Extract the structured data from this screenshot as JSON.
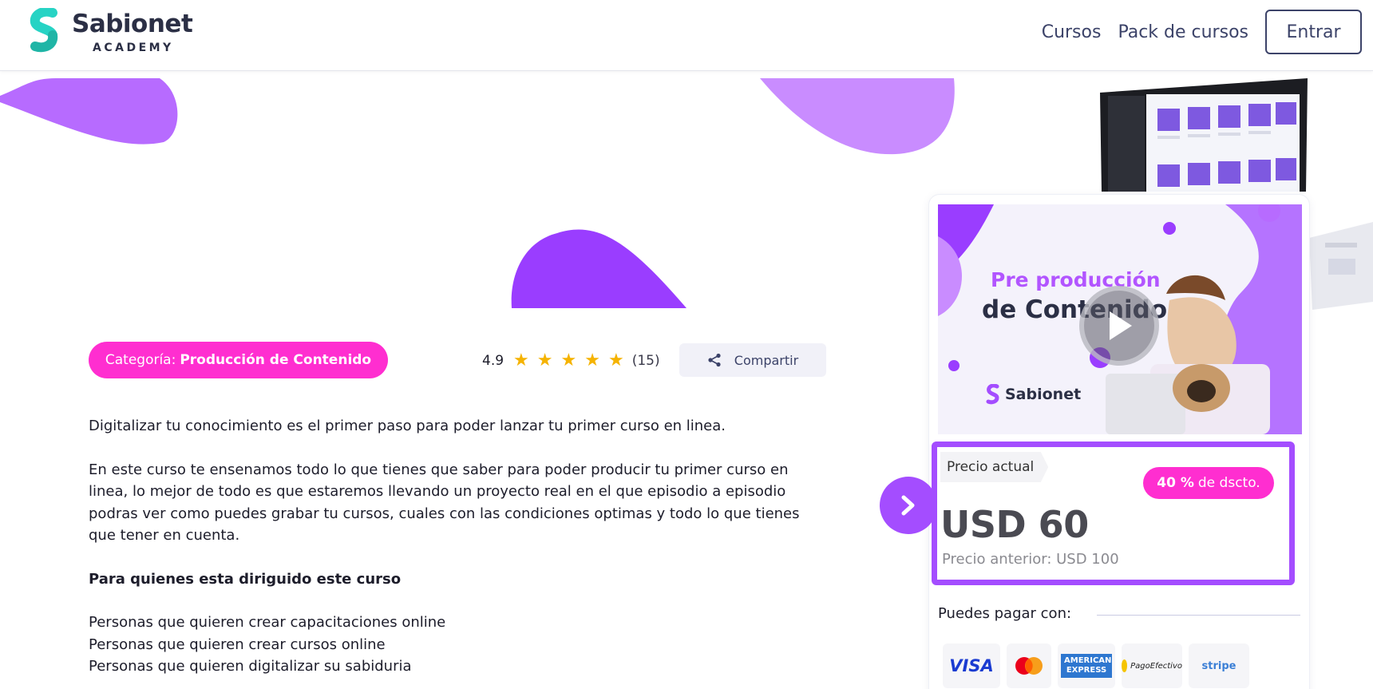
{
  "header": {
    "logo_name": "Sabionet",
    "logo_sub": "ACADEMY",
    "nav": [
      "Cursos",
      "Pack de cursos"
    ],
    "login_label": "Entrar"
  },
  "course": {
    "category_prefix": "Categoría:",
    "category": "Producción de Contenido",
    "rating": "4.9",
    "stars": 5,
    "rating_count": "(15)",
    "share_label": "Compartir"
  },
  "description": {
    "intro": "Digitalizar tu conocimiento es el primer paso para poder lanzar tu primer curso en linea.",
    "body": "En este curso te ensenamos todo lo que tienes que saber para poder producir tu primer curso en linea, lo mejor de todo es que estaremos llevando un proyecto real en el que episodio a episodio podras ver como puedes grabar tu cursos, cuales con las condiciones optimas y todo lo que tienes que tener en cuenta.",
    "audience_heading": "Para quienes esta diriguido este curso",
    "audience": [
      "Personas que quieren crear capacitaciones online",
      "Personas que quieren crear cursos online",
      "Personas que quieren digitalizar su sabiduria"
    ]
  },
  "thumbnail": {
    "title_line1": "Pre producción",
    "title_line2": "de Contenido",
    "brand": "Sabionet"
  },
  "pricing": {
    "current_label": "Precio actual",
    "discount_value": "40 %",
    "discount_suffix": "de dscto.",
    "price": "USD 60",
    "old_price": "Precio anterior: USD 100"
  },
  "payment": {
    "label": "Puedes pagar con:",
    "methods": [
      "VISA",
      "mastercard",
      "AMERICAN EXPRESS",
      "PagoEfectivo",
      "stripe"
    ]
  },
  "colors": {
    "accent_purple": "#a44dff",
    "accent_pink": "#ff2ed0",
    "nav_text": "#3c4369"
  }
}
